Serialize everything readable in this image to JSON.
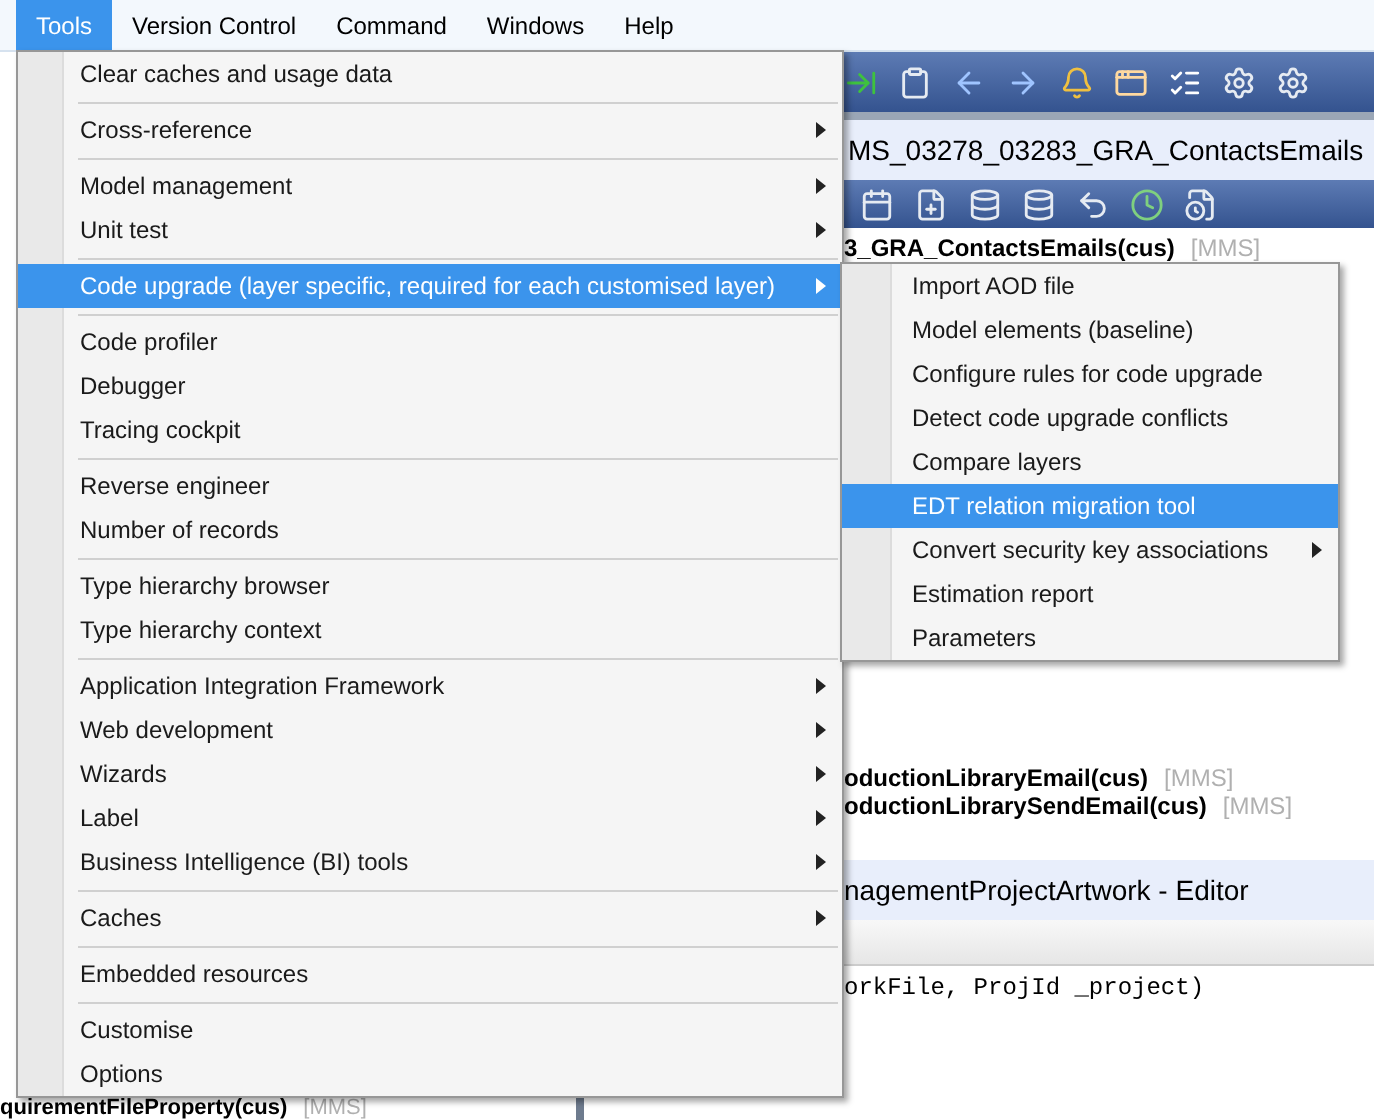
{
  "menubar": [
    {
      "label": "Tools",
      "selected": true
    },
    {
      "label": "Version Control",
      "selected": false
    },
    {
      "label": "Command",
      "selected": false
    },
    {
      "label": "Windows",
      "selected": false
    },
    {
      "label": "Help",
      "selected": false
    }
  ],
  "tools_menu": {
    "groups": [
      [
        {
          "label": "Clear caches and usage data",
          "submenu": false,
          "selected": false
        }
      ],
      [
        {
          "label": "Cross-reference",
          "submenu": true,
          "selected": false
        }
      ],
      [
        {
          "label": "Model management",
          "submenu": true,
          "selected": false
        },
        {
          "label": "Unit test",
          "submenu": true,
          "selected": false
        }
      ],
      [
        {
          "label": "Code upgrade (layer specific, required for each customised layer)",
          "submenu": true,
          "selected": true
        }
      ],
      [
        {
          "label": "Code profiler",
          "submenu": false,
          "selected": false
        },
        {
          "label": "Debugger",
          "submenu": false,
          "selected": false
        },
        {
          "label": "Tracing cockpit",
          "submenu": false,
          "selected": false
        }
      ],
      [
        {
          "label": "Reverse engineer",
          "submenu": false,
          "selected": false
        },
        {
          "label": "Number of records",
          "submenu": false,
          "selected": false
        }
      ],
      [
        {
          "label": "Type hierarchy browser",
          "submenu": false,
          "selected": false
        },
        {
          "label": "Type hierarchy context",
          "submenu": false,
          "selected": false
        }
      ],
      [
        {
          "label": "Application Integration Framework",
          "submenu": true,
          "selected": false
        },
        {
          "label": "Web development",
          "submenu": true,
          "selected": false
        },
        {
          "label": "Wizards",
          "submenu": true,
          "selected": false
        },
        {
          "label": "Label",
          "submenu": true,
          "selected": false
        },
        {
          "label": "Business Intelligence (BI) tools",
          "submenu": true,
          "selected": false
        }
      ],
      [
        {
          "label": "Caches",
          "submenu": true,
          "selected": false
        }
      ],
      [
        {
          "label": "Embedded resources",
          "submenu": false,
          "selected": false
        }
      ],
      [
        {
          "label": "Customise",
          "submenu": false,
          "selected": false
        },
        {
          "label": "Options",
          "submenu": false,
          "selected": false
        }
      ]
    ]
  },
  "code_upgrade_submenu": {
    "items": [
      {
        "label": "Import AOD file",
        "submenu": false,
        "selected": false
      },
      {
        "label": "Model elements (baseline)",
        "submenu": false,
        "selected": false
      },
      {
        "label": "Configure rules for code upgrade",
        "submenu": false,
        "selected": false
      },
      {
        "label": "Detect code upgrade conflicts",
        "submenu": false,
        "selected": false
      },
      {
        "label": "Compare layers",
        "submenu": false,
        "selected": false
      },
      {
        "label": "EDT relation migration tool",
        "submenu": false,
        "selected": true
      },
      {
        "label": "Convert security key associations",
        "submenu": true,
        "selected": false
      },
      {
        "label": "Estimation report",
        "submenu": false,
        "selected": false
      },
      {
        "label": "Parameters",
        "submenu": false,
        "selected": false
      }
    ]
  },
  "project_window": {
    "title": "MS_03278_03283_GRA_ContactsEmails",
    "tree": [
      {
        "name": "3_GRA_ContactsEmails(cus)",
        "layer": "[MMS]"
      },
      {
        "name": "oductionLibraryEmail(cus)",
        "layer": "[MMS]"
      },
      {
        "name": "oductionLibrarySendEmail(cus)",
        "layer": "[MMS]"
      }
    ]
  },
  "editor": {
    "title": "nagementProjectArtwork - Editor",
    "code": "orkFile, ProjId _project)"
  },
  "left_panel": {
    "rows": [
      {
        "name": "quirementFileProperty(cus)",
        "layer": "[MMS]"
      }
    ]
  }
}
